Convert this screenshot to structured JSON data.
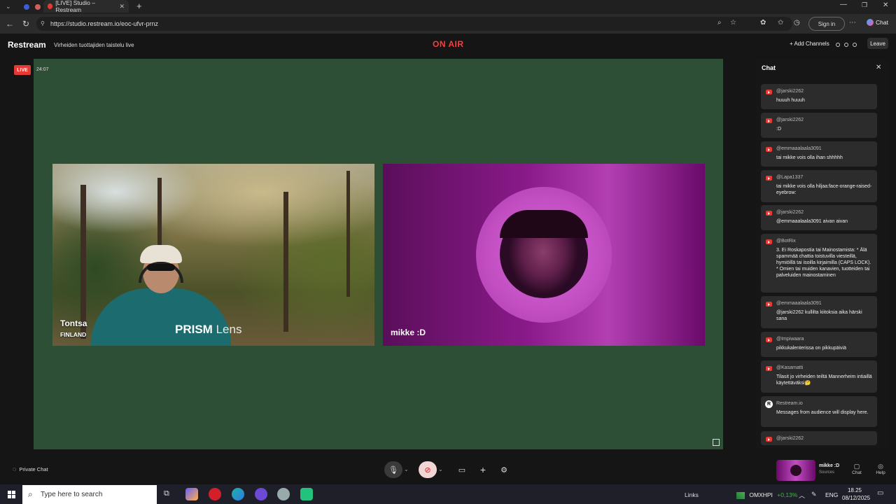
{
  "browser": {
    "tab_title": "[LIVE] Studio – Restream",
    "url": "https://studio.restream.io/eoc-ufvr-prnz",
    "sign_in": "Sign in",
    "chat_label": "Chat"
  },
  "header": {
    "brand": "Restream",
    "stream_title": "Virheiden tuottajiden taistelu live",
    "on_air": "ON AIR",
    "add_channels": "+ Add Channels",
    "leave": "Leave"
  },
  "stage": {
    "live_badge": "LIVE",
    "timer": "24:07",
    "participants": [
      {
        "name": "Tontsa",
        "location": "FINLAND",
        "overlay": "PRISM",
        "overlay2": "Lens"
      },
      {
        "name": "mikke :D"
      }
    ]
  },
  "chat": {
    "title": "Chat",
    "messages": [
      {
        "author": "@jarski2262",
        "text": "huuuh huuuh",
        "source": "youtube"
      },
      {
        "author": "@jarski2262",
        "text": ":D",
        "source": "youtube"
      },
      {
        "author": "@emmaaalaala3091",
        "text": "tai mikke vois olla ihan shhhhh",
        "source": "youtube"
      },
      {
        "author": "@Lapa1337",
        "text": "tai mikke vois olla hiljaa:face-orange-raised-eyebrow:",
        "source": "youtube"
      },
      {
        "author": "@jarski2262",
        "text": "@emmaaalaala3091 aivan aivan",
        "source": "youtube"
      },
      {
        "author": "@BotRix",
        "text": "3. Ei Roskapostia tai Mainostamista: * Älä spammää chattia toistuvilla viesteillä, hymiöillä tai isoilla kirjaimilla (CAPS LOCK). * Omien tai muiden kanavien, tuotteiden tai palveluiden mainostaminen",
        "source": "youtube"
      },
      {
        "author": "@emmaaalaala3091",
        "text": "@jarski2262 kullilta kiitoksia aika härski sana",
        "source": "youtube"
      },
      {
        "author": "@Impiwaara",
        "text": "pikkukalenterissa on pikkupäiviä",
        "source": "youtube"
      },
      {
        "author": "@Kasamatti",
        "text": "Tilasit jo virheiden teiltä Mannerheim intiaillä käytettäväksi🤔",
        "source": "youtube"
      },
      {
        "author": "Restream.io",
        "text": "Messages from audience will display here.",
        "source": "restream"
      },
      {
        "author": "@jarski2262",
        "text": "",
        "source": "youtube"
      }
    ]
  },
  "toolbar": {
    "private_chat": "Private Chat",
    "studio_name": "mikke :D",
    "studio_sub": "Sources",
    "chat": "Chat",
    "help": "Help"
  },
  "taskbar": {
    "search_placeholder": "Type here to search",
    "links": "Links",
    "stock_name": "OMXHPI",
    "stock_change": "+0,13%",
    "language": "ENG",
    "time": "18.25",
    "date": "08/12/2025"
  },
  "colors": {
    "stage_bg": "#2c4f36",
    "on_air": "#ff3b3b",
    "live_badge": "#e53935"
  }
}
